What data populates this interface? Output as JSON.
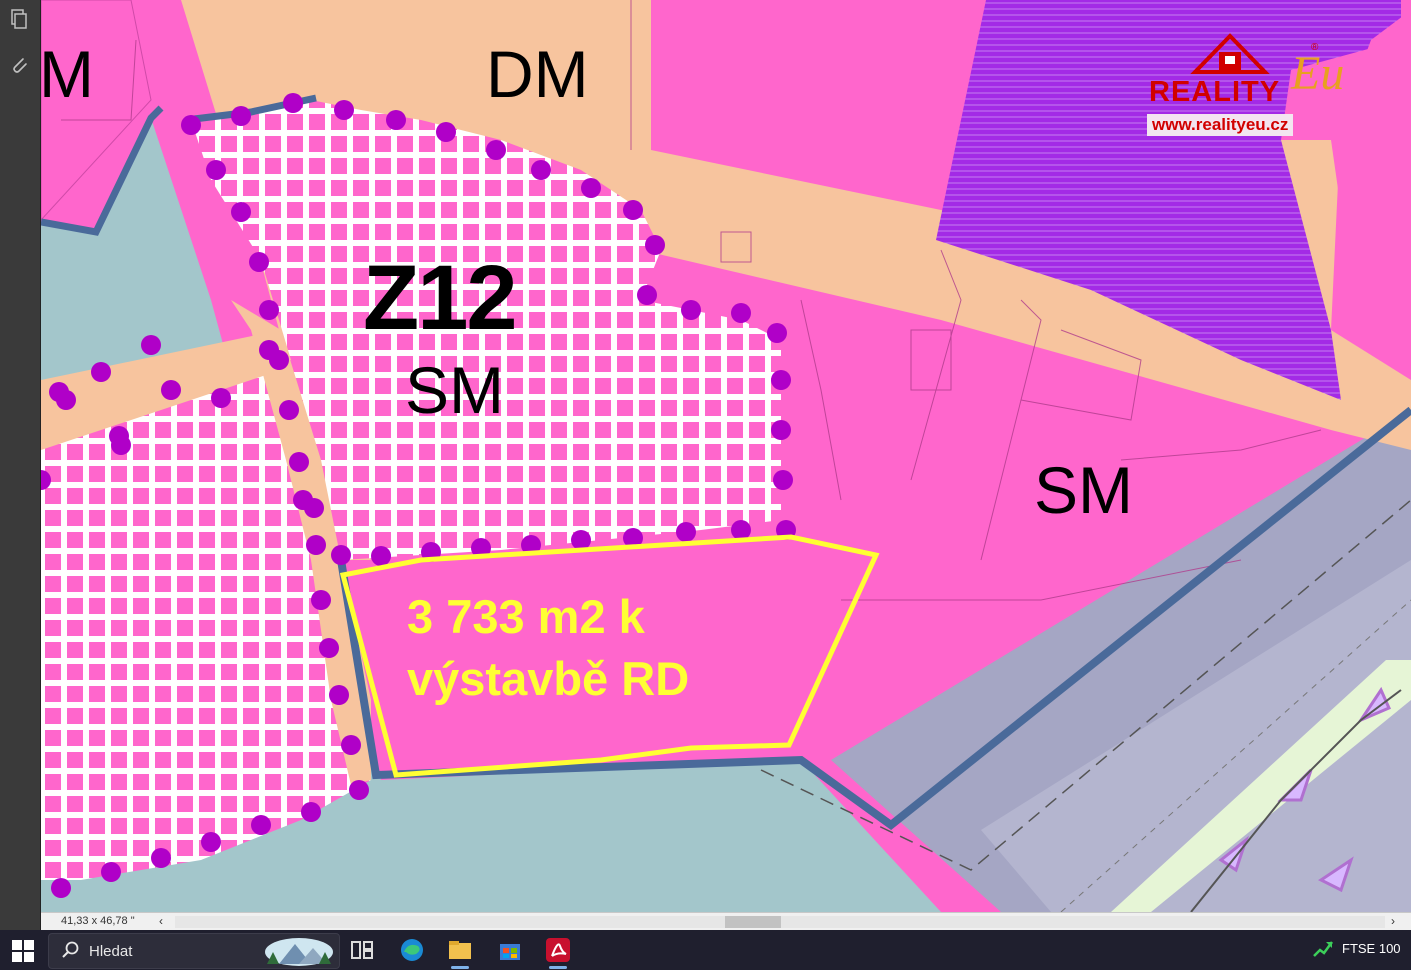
{
  "toolbar": {
    "icons": [
      "pages-icon",
      "attachment-icon"
    ]
  },
  "map": {
    "labels": {
      "z12": "Z12",
      "dm": "DM",
      "m": "M",
      "sm_z12": "SM",
      "sm_right": "SM"
    },
    "callout": {
      "line1": "3 733 m2 k",
      "line2": "výstavbě RD"
    },
    "colors": {
      "residential_pink": "#ff66cc",
      "road_peach": "#f7c49e",
      "water_teal": "#a3c6cb",
      "purple_zone": "#9f1ae0",
      "transport_grey": "#a5a6c4",
      "boundary_blue": "#4a6a9a",
      "development_dots": "#b000c8",
      "callout_yellow": "#ffff33"
    }
  },
  "watermark": {
    "brand": "REALITY",
    "script": "Eu",
    "registered": "®",
    "url": "www.realityeu.cz"
  },
  "status": {
    "page_size": "41,33 x 46,78 \""
  },
  "taskbar": {
    "search_placeholder": "Hledat",
    "ticker": "FTSE 100"
  }
}
